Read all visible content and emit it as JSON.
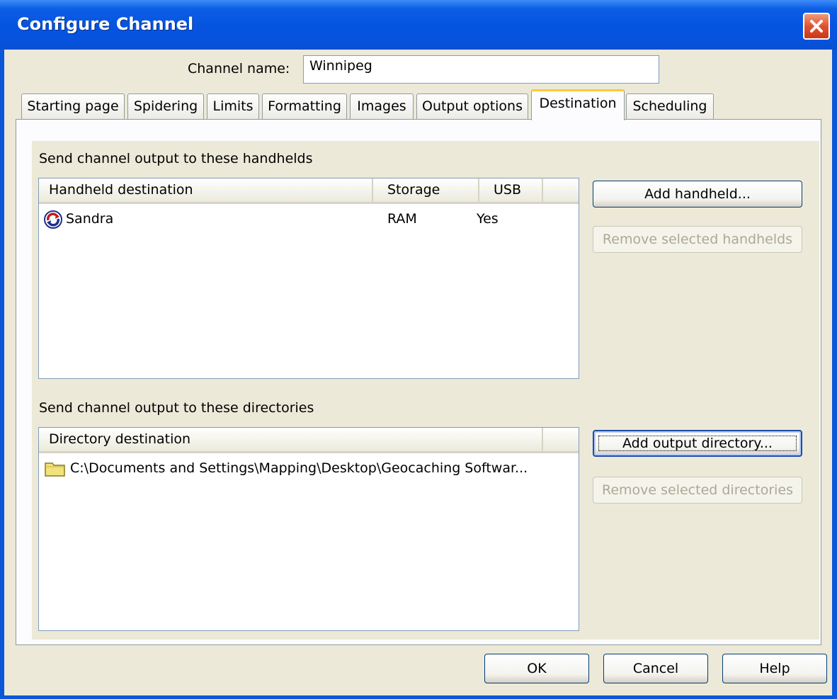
{
  "window": {
    "title": "Configure Channel"
  },
  "channel": {
    "label": "Channel name:",
    "value": "Winnipeg"
  },
  "tabs": [
    {
      "label": "Starting page"
    },
    {
      "label": "Spidering"
    },
    {
      "label": "Limits"
    },
    {
      "label": "Formatting"
    },
    {
      "label": "Images"
    },
    {
      "label": "Output options"
    },
    {
      "label": "Destination",
      "active": true
    },
    {
      "label": "Scheduling"
    }
  ],
  "handhelds": {
    "section_label": "Send channel output to these handhelds",
    "columns": [
      "Handheld destination",
      "Storage",
      "USB"
    ],
    "rows": [
      {
        "icon": "sync-icon",
        "name": "Sandra",
        "storage": "RAM",
        "usb": "Yes"
      }
    ],
    "add_button": "Add handheld...",
    "remove_button": "Remove selected handhelds"
  },
  "directories": {
    "section_label": "Send channel output to these directories",
    "columns": [
      "Directory destination"
    ],
    "rows": [
      {
        "icon": "folder-icon",
        "path": "C:\\Documents and Settings\\Mapping\\Desktop\\Geocaching Softwar..."
      }
    ],
    "add_button": "Add output directory...",
    "remove_button": "Remove selected directories"
  },
  "footer": {
    "ok": "OK",
    "cancel": "Cancel",
    "help": "Help"
  },
  "colors": {
    "titlebar": "#0553df",
    "face": "#ece9d8",
    "tab_highlight": "#ffc83c",
    "close": "#e0532f"
  }
}
